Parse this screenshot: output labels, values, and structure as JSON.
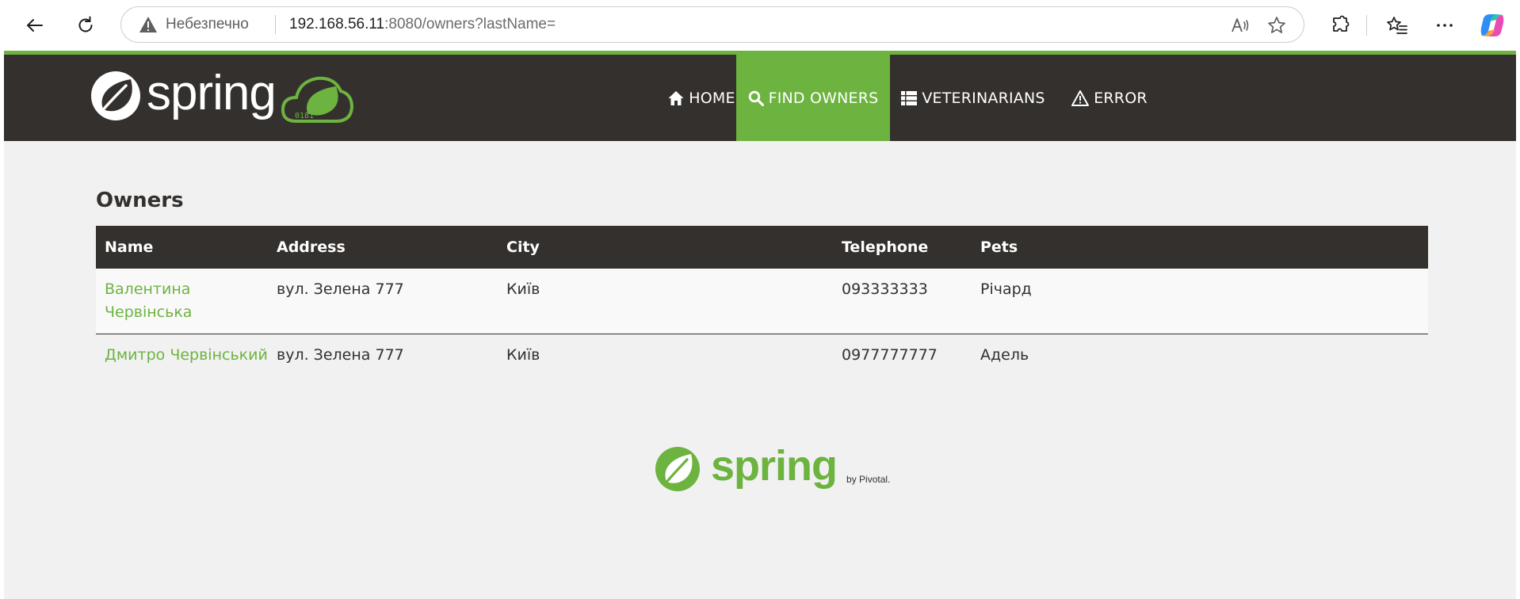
{
  "browser": {
    "security_label": "Небезпечно",
    "url_host": "192.168.56.11",
    "url_rest": ":8080/owners?lastName=",
    "icons": [
      "back-icon",
      "refresh-icon",
      "warning-icon",
      "read-aloud-icon",
      "favorite-star-icon",
      "extensions-icon",
      "favorites-icon",
      "more-icon",
      "copilot-icon"
    ]
  },
  "navbar": {
    "brand": "spring",
    "items": [
      {
        "label": "HOME",
        "icon": "home-icon"
      },
      {
        "label": "FIND OWNERS",
        "icon": "search-icon",
        "active": true
      },
      {
        "label": "VETERINARIANS",
        "icon": "list-icon"
      },
      {
        "label": "ERROR",
        "icon": "warning-icon"
      }
    ]
  },
  "owners": {
    "heading": "Owners",
    "columns": [
      "Name",
      "Address",
      "City",
      "Telephone",
      "Pets"
    ],
    "rows": [
      {
        "name": "Валентина Червінська",
        "address": "вул. Зелена 777",
        "city": "Київ",
        "telephone": "093333333",
        "pets": "Річард"
      },
      {
        "name": "Дмитро Червінський",
        "address": "вул. Зелена 777",
        "city": "Київ",
        "telephone": "0977777777",
        "pets": "Адель"
      }
    ]
  },
  "footer": {
    "brand": "spring",
    "byline": "by Pivotal."
  },
  "colors": {
    "brand_green": "#6db33f",
    "navbar_dark": "#34302d",
    "page_background": "#f1f1f1"
  }
}
